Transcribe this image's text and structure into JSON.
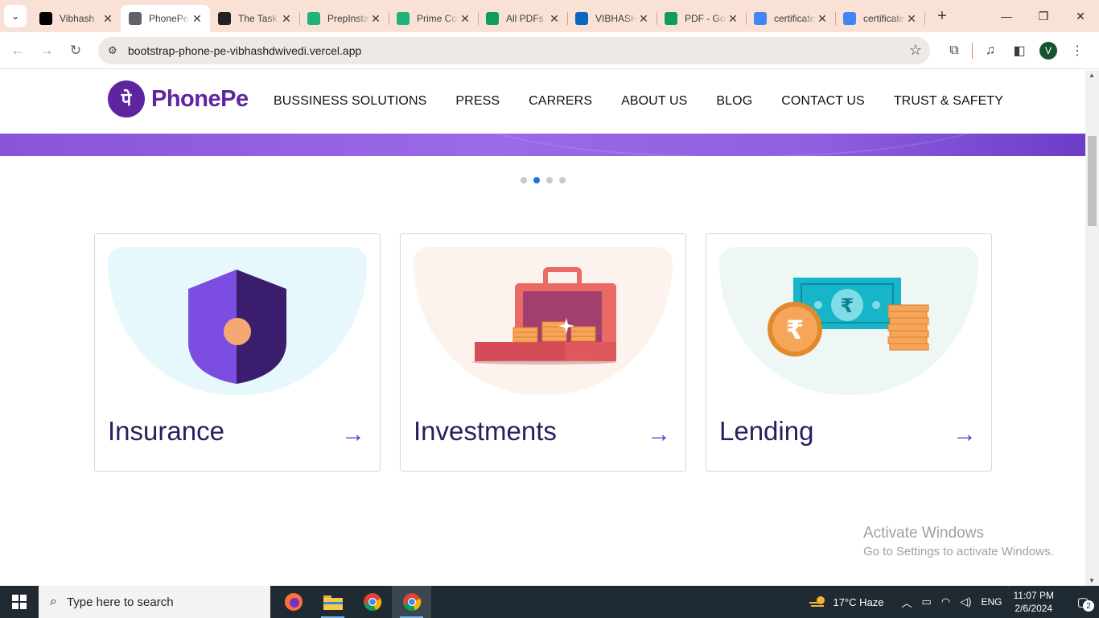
{
  "browser": {
    "tabs": [
      {
        "title": "Vibhash",
        "favicon": "github-icon",
        "color": "#000000"
      },
      {
        "title": "PhonePe",
        "favicon": "globe-icon",
        "color": "#5f6368",
        "active": true
      },
      {
        "title": "The Task",
        "favicon": "task-icon",
        "color": "#222222"
      },
      {
        "title": "PrepInsta",
        "favicon": "prepinsta-icon",
        "color": "#1fb37a"
      },
      {
        "title": "Prime Course",
        "favicon": "prepinsta-icon",
        "color": "#1fb37a"
      },
      {
        "title": "All PDFs",
        "favicon": "google-drive-icon",
        "color": "#0f9d58"
      },
      {
        "title": "VIBHASH",
        "favicon": "linkedin-icon",
        "color": "#0a66c2"
      },
      {
        "title": "PDF - Google Drive",
        "favicon": "google-drive-icon",
        "color": "#0f9d58"
      },
      {
        "title": "certificate",
        "favicon": "google-docs-icon",
        "color": "#4285f4"
      },
      {
        "title": "certificate",
        "favicon": "google-docs-icon",
        "color": "#4285f4"
      }
    ],
    "url": "bootstrap-phone-pe-vibhashdwivedi.vercel.app",
    "profile_initial": "V"
  },
  "site": {
    "brand_initial": "पे",
    "brand_name": "PhonePe",
    "brand_color": "#5f259f",
    "menu": [
      "BUSSINESS SOLUTIONS",
      "PRESS",
      "CARRERS",
      "ABOUT US",
      "BLOG",
      "CONTACT US",
      "TRUST & SAFETY"
    ],
    "carousel": {
      "slides": 4,
      "active_index": 1
    },
    "cards": [
      {
        "title": "Insurance",
        "arrow": "→",
        "illustration": "shield-icon",
        "bg": "#e6f8fc"
      },
      {
        "title": "Investments",
        "arrow": "→",
        "illustration": "briefcase-coins-icon",
        "bg": "#fdf3ee"
      },
      {
        "title": "Lending",
        "arrow": "→",
        "illustration": "rupee-note-coins-icon",
        "bg": "#eef7f3"
      }
    ]
  },
  "watermark": {
    "line1": "Activate Windows",
    "line2": "Go to Settings to activate Windows."
  },
  "taskbar": {
    "search_placeholder": "Type here to search",
    "weather": "17°C  Haze",
    "language": "ENG",
    "time": "11:07 PM",
    "date": "2/6/2024",
    "notifications": "2"
  }
}
